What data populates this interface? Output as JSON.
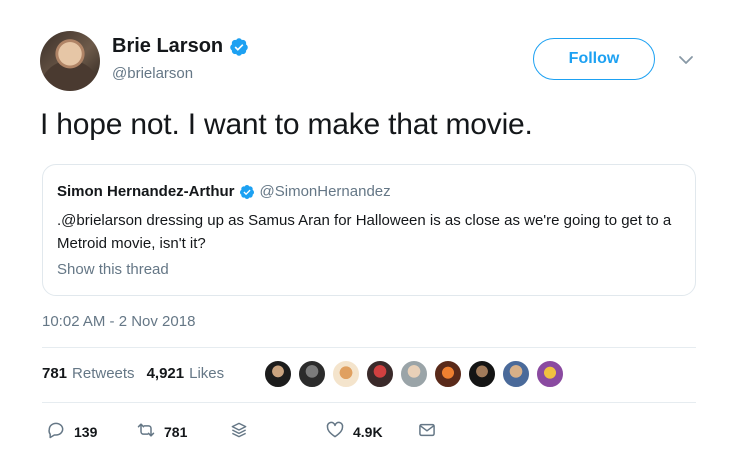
{
  "author": {
    "name": "Brie Larson",
    "handle": "@brielarson",
    "verified": true
  },
  "follow_label": "Follow",
  "tweet_text": "I hope not. I want to make that movie.",
  "quote": {
    "name": "Simon Hernandez-Arthur",
    "handle": "@SimonHernandez",
    "verified": true,
    "text": ".@brielarson dressing up as Samus Aran for Halloween is as close as we're going to get to a Metroid movie, isn't it?",
    "thread_link": "Show this thread"
  },
  "timestamp": "10:02 AM - 2 Nov 2018",
  "stats": {
    "retweets_count": "781",
    "retweets_label": "Retweets",
    "likes_count": "4,921",
    "likes_label": "Likes"
  },
  "actions": {
    "reply_count": "139",
    "retweet_count": "781",
    "like_count": "4.9K"
  },
  "colors": {
    "accent": "#1da1f2",
    "secondary_text": "#657786",
    "primary_text": "#14171a",
    "border": "#e1e8ed"
  }
}
